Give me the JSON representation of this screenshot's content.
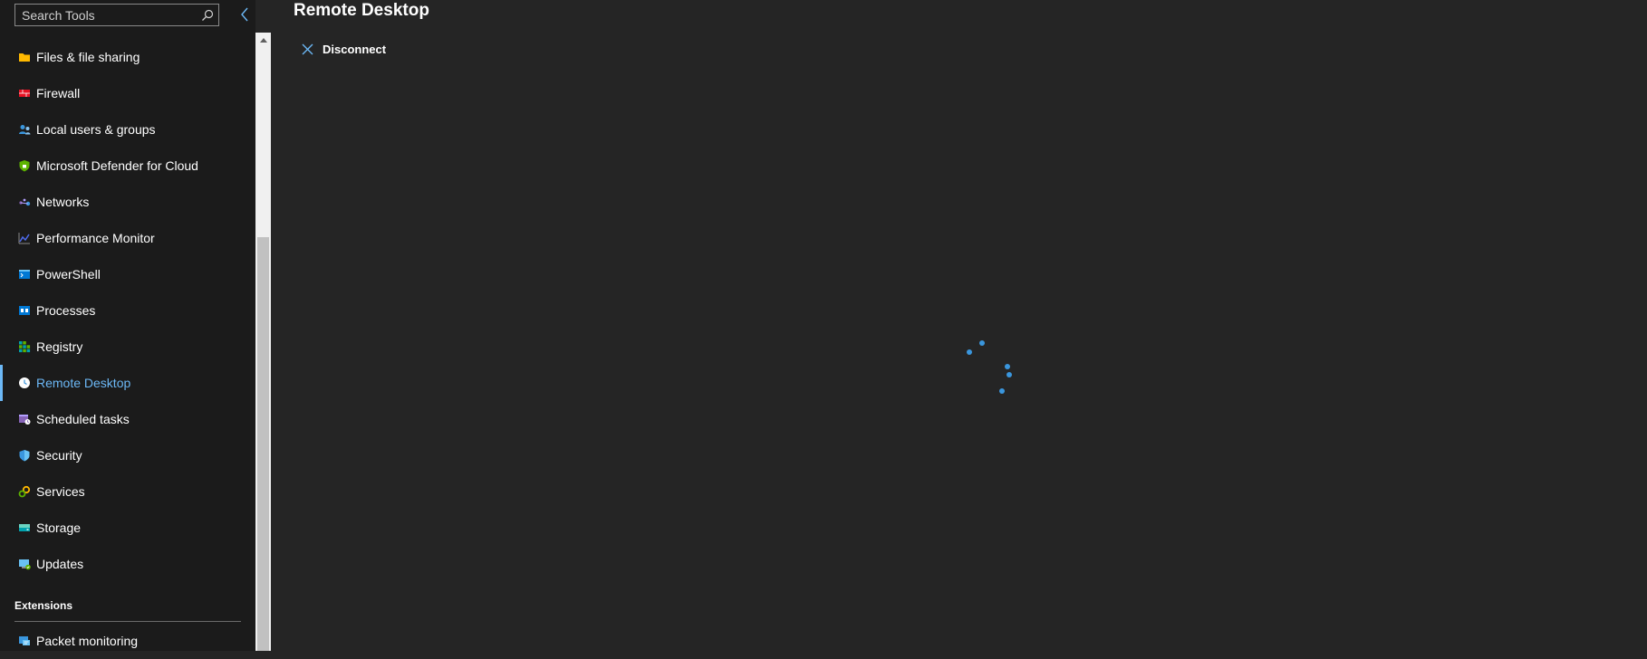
{
  "sidebar": {
    "search": {
      "placeholder": "Search Tools",
      "value": ""
    },
    "items": [
      {
        "label": "Files & file sharing",
        "icon": "folder-icon",
        "color": "#ffb900"
      },
      {
        "label": "Firewall",
        "icon": "firewall-icon",
        "color": "#e81123"
      },
      {
        "label": "Local users & groups",
        "icon": "users-icon",
        "color": "#3a96dd"
      },
      {
        "label": "Microsoft Defender for Cloud",
        "icon": "defender-icon",
        "color": "#5db300"
      },
      {
        "label": "Networks",
        "icon": "network-icon",
        "color": "#8764b8"
      },
      {
        "label": "Performance Monitor",
        "icon": "performance-chart-icon",
        "color": "#4f6bed"
      },
      {
        "label": "PowerShell",
        "icon": "powershell-icon",
        "color": "#0078d4"
      },
      {
        "label": "Processes",
        "icon": "processes-icon",
        "color": "#0078d4"
      },
      {
        "label": "Registry",
        "icon": "registry-icon",
        "color": "#00a2ad"
      },
      {
        "label": "Remote Desktop",
        "icon": "remote-desktop-icon",
        "color": "#ffffff",
        "active": true
      },
      {
        "label": "Scheduled tasks",
        "icon": "scheduled-tasks-icon",
        "color": "#8764b8"
      },
      {
        "label": "Security",
        "icon": "shield-icon",
        "color": "#3a96dd"
      },
      {
        "label": "Services",
        "icon": "services-gear-icon",
        "color": "#5db300"
      },
      {
        "label": "Storage",
        "icon": "storage-icon",
        "color": "#6ad4c2"
      },
      {
        "label": "Updates",
        "icon": "updates-icon",
        "color": "#69c2f4"
      }
    ],
    "extensions": {
      "header": "Extensions",
      "items": [
        {
          "label": "Packet monitoring",
          "icon": "packet-monitoring-icon",
          "color": "#3a96dd"
        }
      ]
    }
  },
  "main": {
    "title": "Remote Desktop",
    "toolbar": {
      "disconnect_label": "Disconnect"
    },
    "loading": true
  },
  "colors": {
    "accent": "#6cb8f6",
    "spinner": "#3a96dd",
    "background": "#252525",
    "sidebar_background": "#1b1b1b"
  }
}
